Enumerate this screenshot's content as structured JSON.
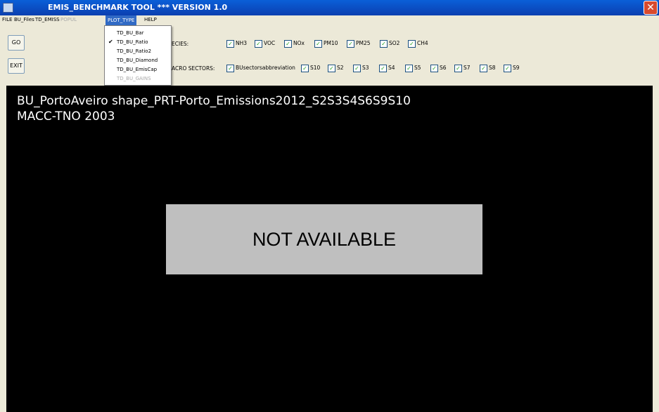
{
  "window": {
    "title": "EMIS_BENCHMARK TOOL *** VERSION 1.0",
    "close_glyph": "✕"
  },
  "menu": {
    "file": "FILE",
    "bu_files": "BU_Files",
    "td_emiss": "TD_EMISS",
    "popul": "POPUL",
    "plot_type": "PLOT_TYPE",
    "help": "HELP"
  },
  "plot_type_menu": {
    "items": [
      "TD_BU_Bar",
      "TD_BU_Ratio",
      "TD_BU_Ratio2",
      "TD_BU_Diamond",
      "TD_BU_EmisCap",
      "TD_BU_GAINS"
    ],
    "checked": "TD_BU_Ratio",
    "disabled": "TD_BU_GAINS",
    "check_glyph": "✔"
  },
  "buttons": {
    "go": "GO",
    "exit": "EXIT"
  },
  "species": {
    "label": "ECIES:",
    "items": [
      "NH3",
      "VOC",
      "NOx",
      "PM10",
      "PM25",
      "SO2",
      "CH4"
    ]
  },
  "sectors": {
    "label": "ACRO SECTORS:",
    "items": [
      "BUsectorsabbreviation",
      "S10",
      "S2",
      "S3",
      "S4",
      "S5",
      "S6",
      "S7",
      "S8",
      "S9"
    ]
  },
  "checkbox_glyph": "✓",
  "plot": {
    "title_line1": "BU_PortoAveiro shape_PRT-Porto_Emissions2012_S2S3S4S6S9S10",
    "title_line2": "MACC-TNO 2003",
    "message": "NOT AVAILABLE"
  }
}
